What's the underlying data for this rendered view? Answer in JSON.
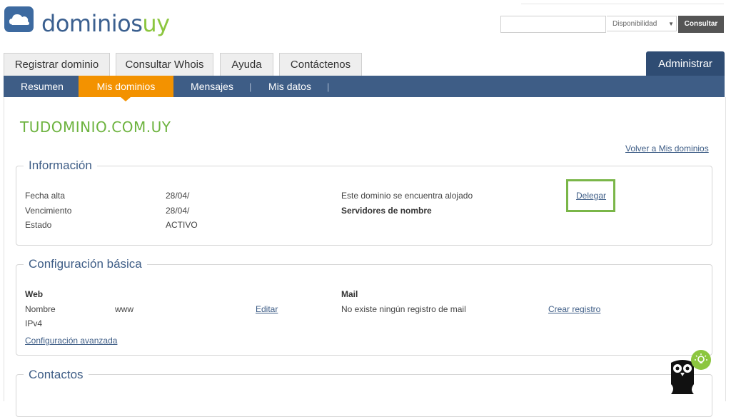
{
  "header": {
    "logo_part1": "dominios",
    "logo_part2": "uy",
    "search_placeholder": "",
    "select_value": "Disponibilidad",
    "search_button": "Consultar"
  },
  "tabs": [
    {
      "label": "Registrar dominio"
    },
    {
      "label": "Consultar Whois"
    },
    {
      "label": "Ayuda"
    },
    {
      "label": "Contáctenos"
    }
  ],
  "admin_tab": "Administrar",
  "subnav": [
    {
      "label": "Resumen"
    },
    {
      "label": "Mis dominios"
    },
    {
      "label": "Mensajes"
    },
    {
      "label": "Mis datos"
    }
  ],
  "separator": "|",
  "domain": "TUDOMINIO.COM.UY",
  "back_link": "Volver a Mis dominios",
  "info": {
    "title": "Información",
    "fecha_alta_label": "Fecha alta",
    "fecha_alta_value": "28/04/",
    "vencimiento_label": "Vencimiento",
    "vencimiento_value": "28/04/",
    "estado_label": "Estado",
    "estado_value": "ACTIVO",
    "alojado_text": "Este dominio se encuentra alojado",
    "servidores_label": "Servidores de nombre",
    "delegar_link": "Delegar"
  },
  "config": {
    "title": "Configuración básica",
    "web_label": "Web",
    "nombre_label": "Nombre",
    "nombre_value": "www",
    "editar_link": "Editar",
    "ipv4_label": "IPv4",
    "advanced_link": "Configuración avanzada",
    "mail_label": "Mail",
    "mail_text": "No existe ningún registro de mail",
    "crear_link": "Crear registro"
  },
  "contactos": {
    "title": "Contactos"
  },
  "colors": {
    "primary_blue": "#3e5d86",
    "dark_blue": "#2f4c73",
    "orange": "#f39200",
    "green": "#6db33f",
    "highlight_green": "#7ab648"
  }
}
